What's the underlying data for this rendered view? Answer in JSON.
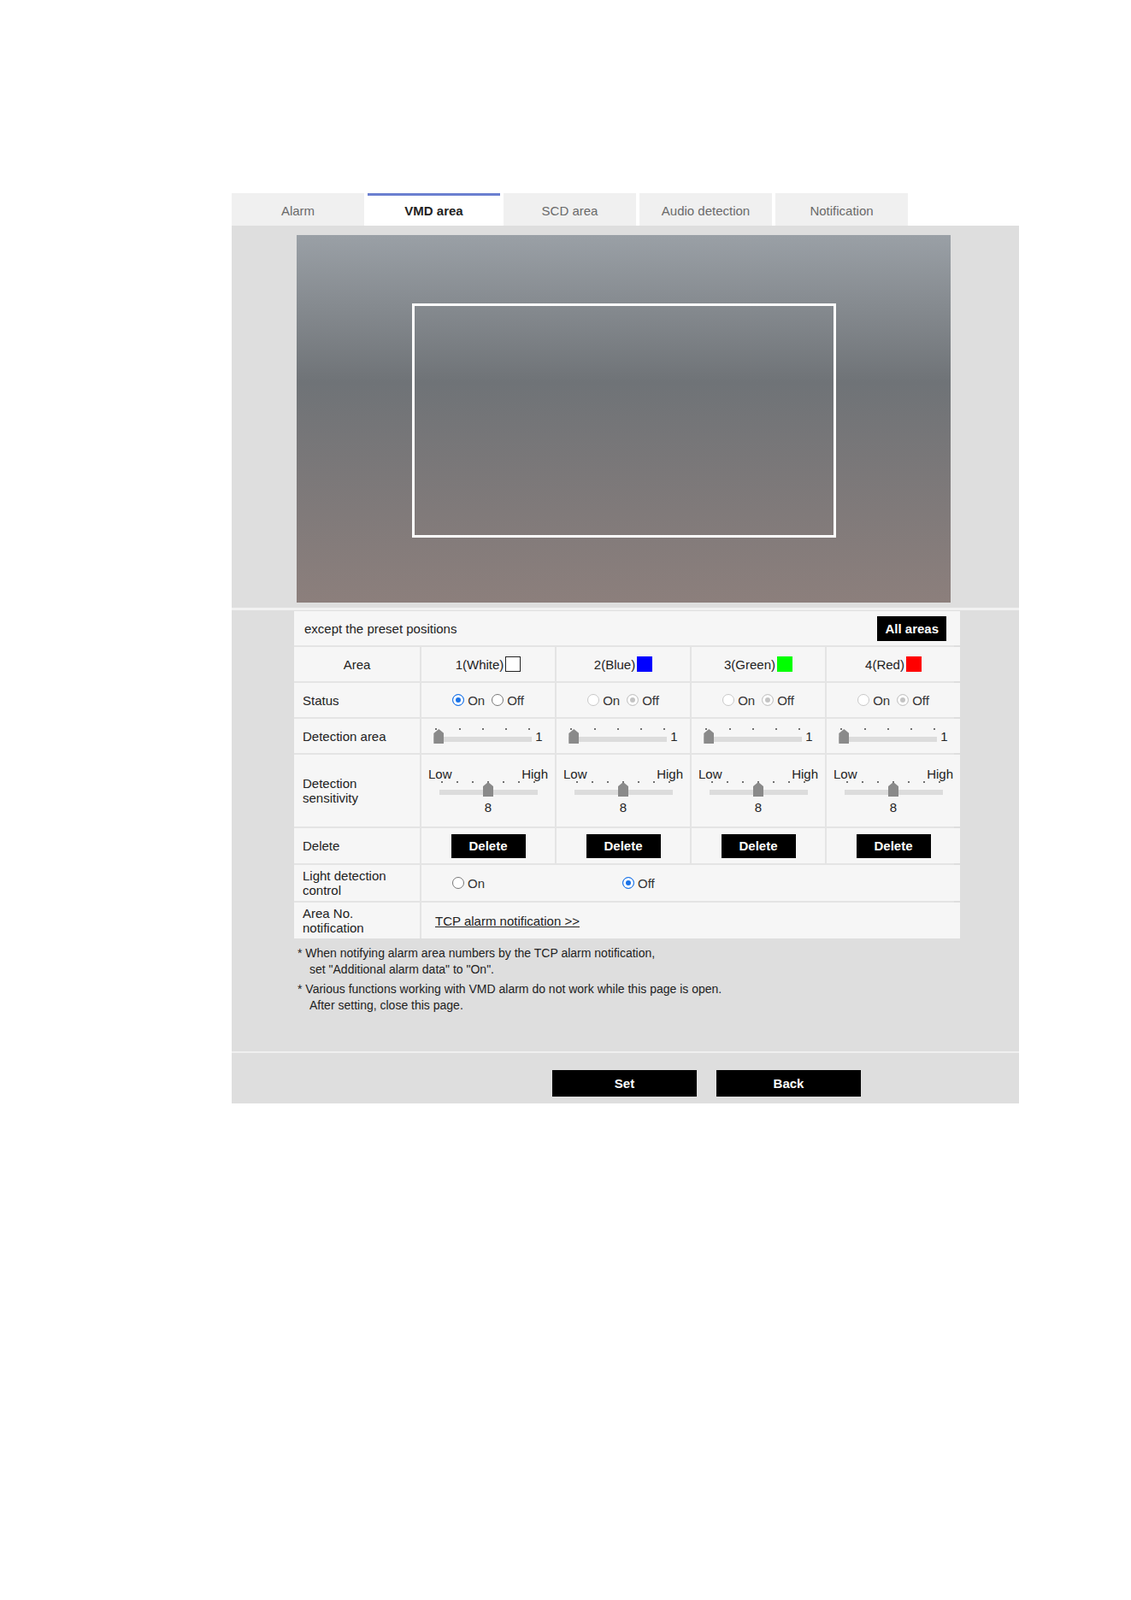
{
  "tabs": [
    {
      "label": "Alarm",
      "selected": false
    },
    {
      "label": "VMD area",
      "selected": true
    },
    {
      "label": "SCD area",
      "selected": false
    },
    {
      "label": "Audio detection",
      "selected": false
    },
    {
      "label": "Notification",
      "selected": false
    }
  ],
  "preset_note": "except the preset positions",
  "all_areas_button": "All areas",
  "row_labels": {
    "area": "Area",
    "status": "Status",
    "detection_area": "Detection area",
    "sensitivity": "Detection sensitivity",
    "delete": "Delete"
  },
  "areas": [
    {
      "name": "1(White)",
      "color": "#ffffff",
      "status": {
        "disabled": false,
        "options": [
          {
            "label": "On",
            "selected": true
          },
          {
            "label": "Off",
            "selected": false
          }
        ]
      },
      "detection_area": {
        "level": 0,
        "reading": "1"
      },
      "sensitivity": {
        "low": "Low",
        "high": "High",
        "level": 0.5,
        "reading": "8"
      },
      "delete": "Delete"
    },
    {
      "name": "2(Blue)",
      "color": "#0000ff",
      "status": {
        "disabled": true,
        "options": [
          {
            "label": "On",
            "selected": false
          },
          {
            "label": "Off",
            "selected": true
          }
        ]
      },
      "detection_area": {
        "level": 0,
        "reading": "1"
      },
      "sensitivity": {
        "low": "Low",
        "high": "High",
        "level": 0.5,
        "reading": "8"
      },
      "delete": "Delete"
    },
    {
      "name": "3(Green)",
      "color": "#00ff00",
      "status": {
        "disabled": true,
        "options": [
          {
            "label": "On",
            "selected": false
          },
          {
            "label": "Off",
            "selected": true
          }
        ]
      },
      "detection_area": {
        "level": 0,
        "reading": "1"
      },
      "sensitivity": {
        "low": "Low",
        "high": "High",
        "level": 0.5,
        "reading": "8"
      },
      "delete": "Delete"
    },
    {
      "name": "4(Red)",
      "color": "#ff0000",
      "status": {
        "disabled": true,
        "options": [
          {
            "label": "On",
            "selected": false
          },
          {
            "label": "Off",
            "selected": true
          }
        ]
      },
      "detection_area": {
        "level": 0,
        "reading": "1"
      },
      "sensitivity": {
        "low": "Low",
        "high": "High",
        "level": 0.5,
        "reading": "8"
      },
      "delete": "Delete"
    }
  ],
  "light_detection_control": {
    "label": "Light detection control",
    "options": [
      {
        "label": "On",
        "selected": false
      },
      {
        "label": "Off",
        "selected": true
      }
    ]
  },
  "area_no_notification": {
    "label": "Area No. notification",
    "link": "TCP alarm notification >>"
  },
  "notes": [
    [
      "* When notifying alarm area numbers by the TCP alarm notification,",
      "set \"Additional alarm data\" to \"On\"."
    ],
    [
      "* Various functions working with VMD alarm do not work while this page is open.",
      "After setting, close this page."
    ]
  ],
  "buttons": [
    "Set",
    "Back"
  ]
}
